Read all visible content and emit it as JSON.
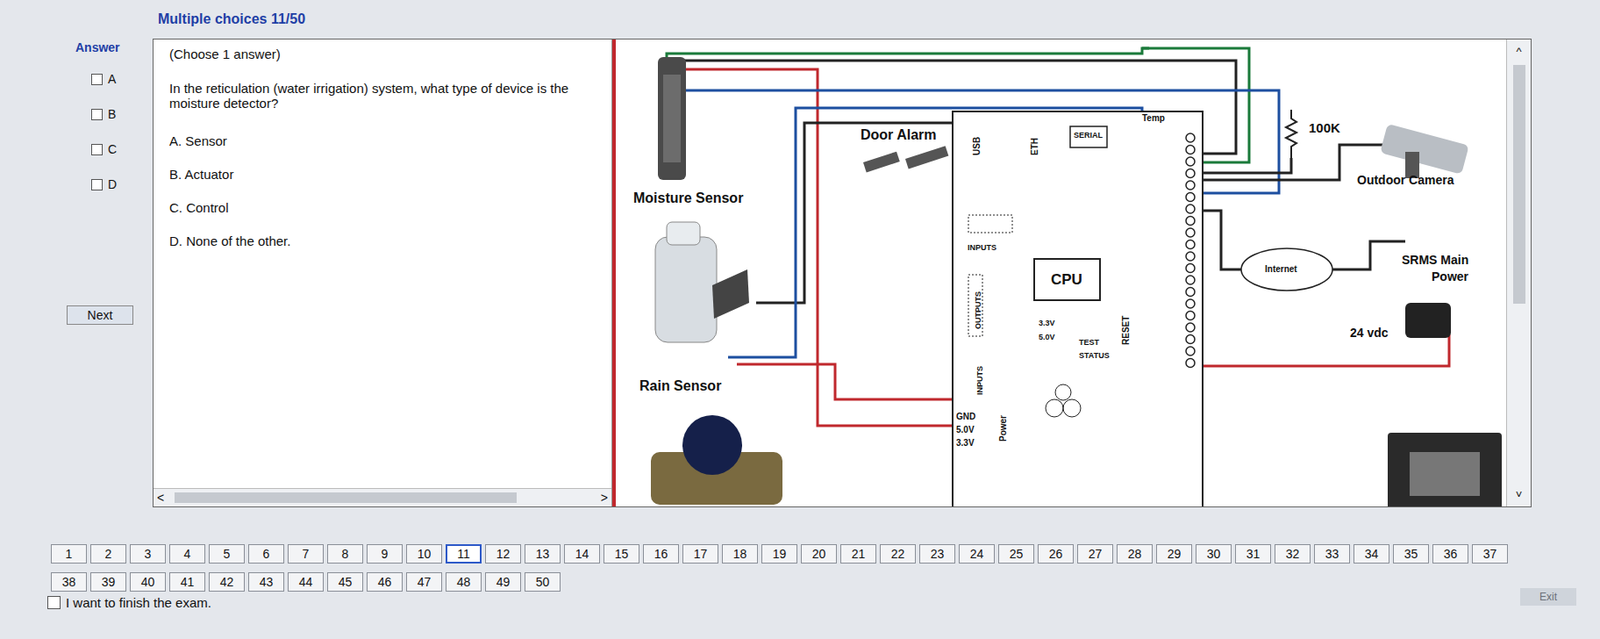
{
  "header": {
    "title": "Multiple choices 11/50"
  },
  "answer_panel": {
    "label": "Answer",
    "options": [
      {
        "letter": "A",
        "checked": false
      },
      {
        "letter": "B",
        "checked": false
      },
      {
        "letter": "C",
        "checked": false
      },
      {
        "letter": "D",
        "checked": false
      }
    ]
  },
  "question": {
    "instruction": "(Choose 1 answer)",
    "text": "In the reticulation  (water irrigation) system, what type of device is the moisture detector?",
    "choices": [
      "A. Sensor",
      "B. Actuator",
      "C. Control",
      "D. None of the other."
    ]
  },
  "next_button": "Next",
  "scrollbars": {
    "left": "<",
    "right": ">",
    "up": "^",
    "down": "˅"
  },
  "diagram": {
    "labels": [
      "Door Alarm",
      "Moisture Sensor",
      "Rain Sensor",
      "100K",
      "Outdoor Camera",
      "Internet",
      "SRMS Main",
      "Power",
      "24 vdc",
      "CPU",
      "USB",
      "ETH",
      "SERIAL",
      "Temp",
      "INPUTS",
      "OUTPUTS",
      "3.3V",
      "5.0V",
      "TEST",
      "STATUS",
      "RESET",
      "INPUTS",
      "GND",
      "5.0V",
      "3.3V",
      "Power"
    ]
  },
  "pagination": {
    "pages": [
      {
        "label": "1",
        "selected": false
      },
      {
        "label": "2",
        "selected": false
      },
      {
        "label": "3",
        "selected": false
      },
      {
        "label": "4",
        "selected": false
      },
      {
        "label": "5",
        "selected": false
      },
      {
        "label": "6",
        "selected": false
      },
      {
        "label": "7",
        "selected": false
      },
      {
        "label": "8",
        "selected": false
      },
      {
        "label": "9",
        "selected": false
      },
      {
        "label": "10",
        "selected": false
      },
      {
        "label": "11",
        "selected": true
      },
      {
        "label": "12",
        "selected": false
      },
      {
        "label": "13",
        "selected": false
      },
      {
        "label": "14",
        "selected": false
      },
      {
        "label": "15",
        "selected": false
      },
      {
        "label": "16",
        "selected": false
      },
      {
        "label": "17",
        "selected": false
      },
      {
        "label": "18",
        "selected": false
      },
      {
        "label": "19",
        "selected": false
      },
      {
        "label": "20",
        "selected": false
      },
      {
        "label": "21",
        "selected": false
      },
      {
        "label": "22",
        "selected": false
      },
      {
        "label": "23",
        "selected": false
      },
      {
        "label": "24",
        "selected": false
      },
      {
        "label": "25",
        "selected": false
      },
      {
        "label": "26",
        "selected": false
      },
      {
        "label": "27",
        "selected": false
      },
      {
        "label": "28",
        "selected": false
      },
      {
        "label": "29",
        "selected": false
      },
      {
        "label": "30",
        "selected": false
      },
      {
        "label": "31",
        "selected": false
      },
      {
        "label": "32",
        "selected": false
      },
      {
        "label": "33",
        "selected": false
      },
      {
        "label": "34",
        "selected": false
      },
      {
        "label": "35",
        "selected": false
      },
      {
        "label": "36",
        "selected": false
      },
      {
        "label": "37",
        "selected": false
      },
      {
        "label": "38",
        "selected": false
      },
      {
        "label": "39",
        "selected": false
      },
      {
        "label": "40",
        "selected": false
      },
      {
        "label": "41",
        "selected": false
      },
      {
        "label": "42",
        "selected": false
      },
      {
        "label": "43",
        "selected": false
      },
      {
        "label": "44",
        "selected": false
      },
      {
        "label": "45",
        "selected": false
      },
      {
        "label": "46",
        "selected": false
      },
      {
        "label": "47",
        "selected": false
      },
      {
        "label": "48",
        "selected": false
      },
      {
        "label": "49",
        "selected": false
      },
      {
        "label": "50",
        "selected": false
      }
    ]
  },
  "finish": {
    "label": "I want to finish the exam.",
    "checked": false
  },
  "exit_button": "Exit"
}
